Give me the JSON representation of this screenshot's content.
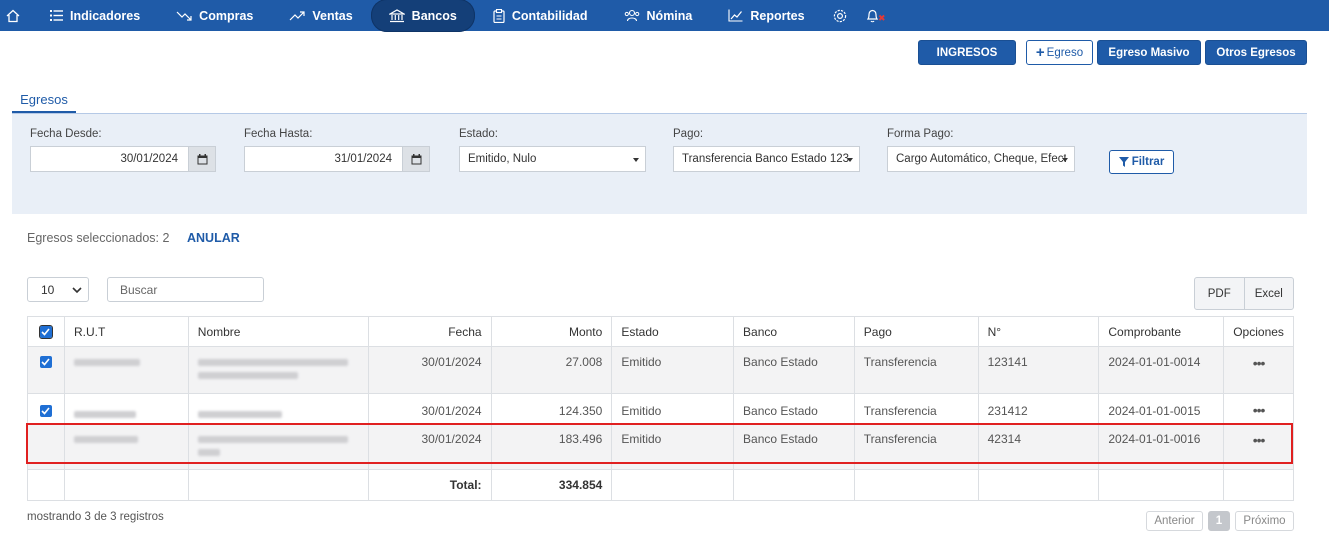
{
  "nav": {
    "items": [
      {
        "label": "Indicadores",
        "icon": "list-icon"
      },
      {
        "label": "Compras",
        "icon": "trend-down-icon"
      },
      {
        "label": "Ventas",
        "icon": "trend-up-icon"
      },
      {
        "label": "Bancos",
        "icon": "bank-icon"
      },
      {
        "label": "Contabilidad",
        "icon": "clipboard-icon"
      },
      {
        "label": "Nómina",
        "icon": "people-icon"
      },
      {
        "label": "Reportes",
        "icon": "chart-line-icon"
      }
    ],
    "active": "Bancos"
  },
  "actions": {
    "ingresos": "INGRESOS",
    "egreso": "Egreso",
    "egreso_masivo": "Egreso Masivo",
    "otros_egresos": "Otros Egresos"
  },
  "tab": "Egresos",
  "filters": {
    "fecha_desde_label": "Fecha Desde:",
    "fecha_desde_value": "30/01/2024",
    "fecha_hasta_label": "Fecha Hasta:",
    "fecha_hasta_value": "31/01/2024",
    "estado_label": "Estado:",
    "estado_value": "Emitido, Nulo",
    "pago_label": "Pago:",
    "pago_value": "Transferencia Banco Estado 123-",
    "forma_pago_label": "Forma Pago:",
    "forma_pago_value": "Cargo Automático, Cheque, Efect",
    "filtrar": "Filtrar"
  },
  "selection": {
    "text": "Egresos seleccionados: 2",
    "anular": "ANULAR"
  },
  "table_controls": {
    "page_size": "10",
    "search_placeholder": "Buscar",
    "pdf": "PDF",
    "excel": "Excel"
  },
  "table": {
    "headers": [
      "R.U.T",
      "Nombre",
      "Fecha",
      "Monto",
      "Estado",
      "Banco",
      "Pago",
      "N°",
      "Comprobante",
      "Opciones"
    ],
    "rows": [
      {
        "checked": true,
        "fecha": "30/01/2024",
        "monto": "27.008",
        "estado": "Emitido",
        "banco": "Banco Estado",
        "pago": "Transferencia",
        "numero": "123141",
        "comprobante": "2024-01-01-0014",
        "opciones": "•••"
      },
      {
        "checked": true,
        "fecha": "30/01/2024",
        "monto": "124.350",
        "estado": "Emitido",
        "banco": "Banco Estado",
        "pago": "Transferencia",
        "numero": "231412",
        "comprobante": "2024-01-01-0015",
        "opciones": "•••"
      },
      {
        "checked": false,
        "fecha": "30/01/2024",
        "monto": "183.496",
        "estado": "Emitido",
        "banco": "Banco Estado",
        "pago": "Transferencia",
        "numero": "42314",
        "comprobante": "2024-01-01-0016",
        "opciones": "•••"
      }
    ],
    "total_label": "Total:",
    "total_value": "334.854"
  },
  "footer": {
    "showing": "mostrando 3 de 3 registros",
    "anterior": "Anterior",
    "page": "1",
    "proximo": "Próximo"
  },
  "colors": {
    "primary": "#1f5ba8",
    "highlight": "#e02020",
    "checkbox": "#1f6fd4"
  }
}
